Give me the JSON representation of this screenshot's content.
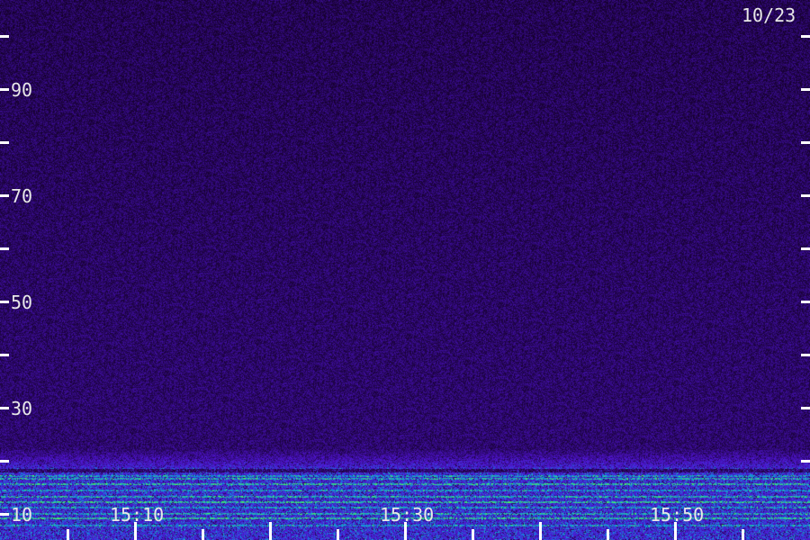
{
  "date_label": "10/23",
  "y_axis": {
    "tick_labels": [
      "90",
      "70",
      "50",
      "30",
      "10"
    ]
  },
  "x_axis": {
    "tick_labels": [
      "15:10",
      "15:30",
      "15:50"
    ]
  },
  "colors": {
    "background": "#000000",
    "noise_purple": "#4a1fc8",
    "band_cyan": "#19d6c4",
    "band_green": "#4cff6a",
    "label": "#e8e8e8"
  }
}
